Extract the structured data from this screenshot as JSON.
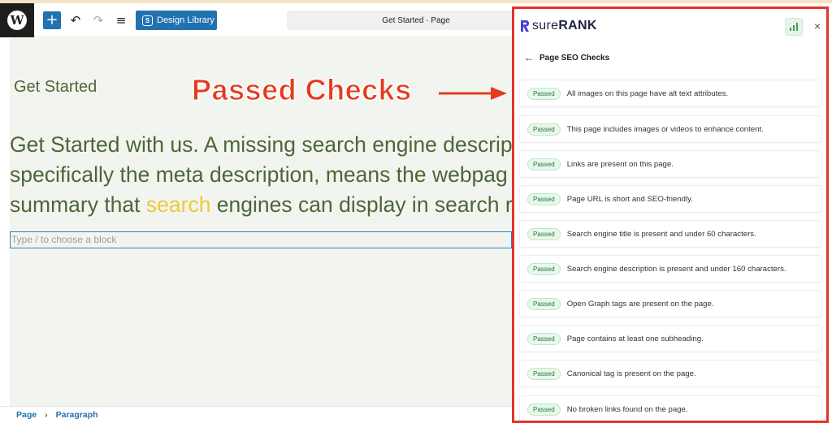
{
  "toolbar": {
    "wp_logo": "W",
    "add_label": "+",
    "undo_icon": "↶",
    "redo_icon": "↷",
    "list_icon": "≡",
    "design_library": "Design Library",
    "design_library_badge": "S",
    "document_title": "Get Started · Page"
  },
  "editor": {
    "heading": "Get Started",
    "body_line_1": "Get Started with us. A missing search engine descrip",
    "body_line_2": "specifically the meta description, means the webpag",
    "body_line_3a": "summary that ",
    "body_line_3_highlight": "search",
    "body_line_3b": " engines can display in search r",
    "block_placeholder": "Type / to choose a block",
    "highlight_color": "#ecc93a"
  },
  "annotation": {
    "text": "Passed Checks",
    "color": "#e63a1e"
  },
  "footer": {
    "crumb_1": "Page",
    "separator": "›",
    "crumb_2": "Paragraph"
  },
  "panel": {
    "brand_light": "sure",
    "brand_bold": "RANK",
    "close_icon": "×",
    "back_arrow": "←",
    "back_label": "Page SEO Checks",
    "border_color": "#e0352b",
    "checks": [
      {
        "status": "Passed",
        "text": "All images on this page have alt text attributes."
      },
      {
        "status": "Passed",
        "text": "This page includes images or videos to enhance content."
      },
      {
        "status": "Passed",
        "text": "Links are present on this page."
      },
      {
        "status": "Passed",
        "text": "Page URL is short and SEO-friendly."
      },
      {
        "status": "Passed",
        "text": "Search engine title is present and under 60 characters."
      },
      {
        "status": "Passed",
        "text": "Search engine description is present and under 160 characters."
      },
      {
        "status": "Passed",
        "text": "Open Graph tags are present on the page."
      },
      {
        "status": "Passed",
        "text": "Page contains at least one subheading."
      },
      {
        "status": "Passed",
        "text": "Canonical tag is present on the page."
      },
      {
        "status": "Passed",
        "text": "No broken links found on the page."
      }
    ]
  }
}
